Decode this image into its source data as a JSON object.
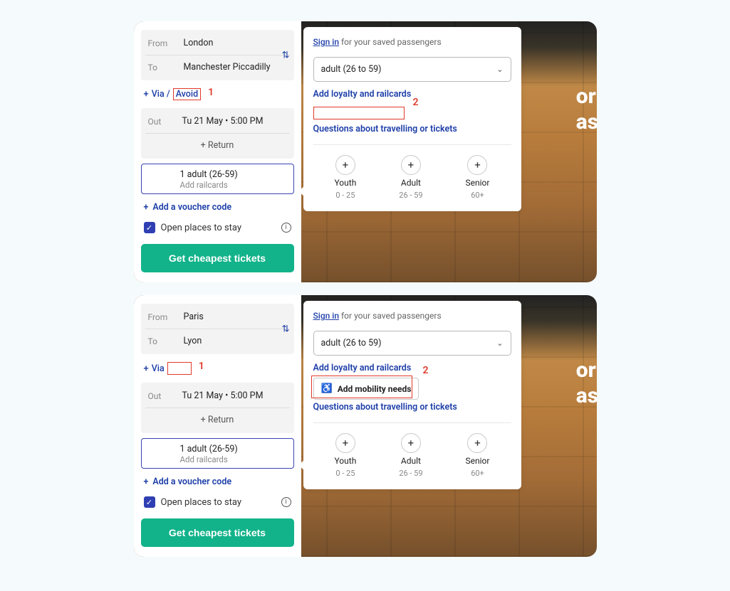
{
  "instances": [
    {
      "from_label": "From",
      "from_value": "London",
      "to_label": "To",
      "to_value": "Manchester Piccadilly",
      "via_text": "Via /",
      "via_avoid": "Avoid",
      "show_avoid": true,
      "annotation1": "1",
      "out_label": "Out",
      "out_value": "Tu 21 May • 5:00 PM",
      "return_text": "+ Return",
      "pax_main": "1 adult (26-59)",
      "pax_sub": "Add railcards",
      "voucher": "Add a voucher code",
      "stay": "Open places to stay",
      "cta": "Get cheapest tickets",
      "signin": "Sign in",
      "signin_tail": " for your saved passengers",
      "sel_text": "adult (26 to 59)",
      "loyalty": "Add loyalty and railcards",
      "show_mobility": false,
      "annotation2": "2",
      "faq": "Questions about travelling or tickets",
      "bg_line1": "or",
      "bg_line2": "asy",
      "groups": [
        {
          "label": "Youth",
          "range": "0 - 25"
        },
        {
          "label": "Adult",
          "range": "26 - 59"
        },
        {
          "label": "Senior",
          "range": "60+"
        }
      ]
    },
    {
      "from_label": "From",
      "from_value": "Paris",
      "to_label": "To",
      "to_value": "Lyon",
      "via_text": "Via",
      "via_avoid": "",
      "show_avoid": false,
      "annotation1": "1",
      "out_label": "Out",
      "out_value": "Tu 21 May • 5:00 PM",
      "return_text": "+ Return",
      "pax_main": "1 adult (26-59)",
      "pax_sub": "Add railcards",
      "voucher": "Add a voucher code",
      "stay": "Open places to stay",
      "cta": "Get cheapest tickets",
      "signin": "Sign in",
      "signin_tail": " for your saved passengers",
      "sel_text": "adult (26 to 59)",
      "loyalty": "Add loyalty and railcards",
      "show_mobility": true,
      "mobility": "Add mobility needs",
      "annotation2": "2",
      "faq": "Questions about travelling or tickets",
      "bg_line1": "or",
      "bg_line2": "asy",
      "groups": [
        {
          "label": "Youth",
          "range": "0 - 25"
        },
        {
          "label": "Adult",
          "range": "26 - 59"
        },
        {
          "label": "Senior",
          "range": "60+"
        }
      ]
    }
  ]
}
